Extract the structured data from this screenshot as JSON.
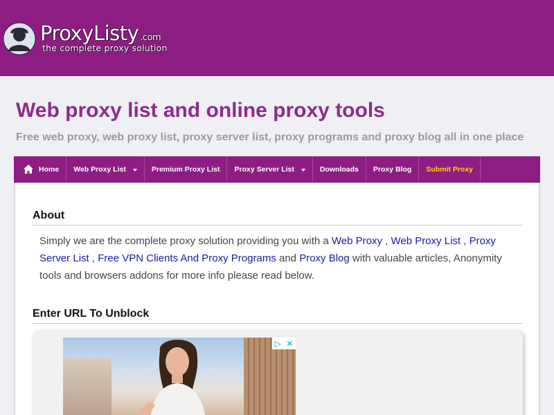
{
  "header": {
    "logo_text": "ProxyListy",
    "logo_tld": ".com",
    "logo_tagline": "the complete proxy solution"
  },
  "page": {
    "title": "Web proxy list and online proxy tools",
    "subtitle": "Free web proxy, web proxy list, proxy server list, proxy programs and proxy blog all in one place"
  },
  "nav": {
    "items": [
      {
        "label": "Home",
        "icon": "home-icon"
      },
      {
        "label": "Web Proxy List",
        "dropdown": true
      },
      {
        "label": "Premium Proxy List"
      },
      {
        "label": "Proxy Server List",
        "dropdown": true
      },
      {
        "label": "Downloads"
      },
      {
        "label": "Proxy Blog"
      },
      {
        "label": "Submit Proxy",
        "highlight": true
      }
    ]
  },
  "about": {
    "heading": "About",
    "t1": "Simply we are the complete proxy solution providing you with a ",
    "l1": "Web Proxy",
    "t2": " , ",
    "l2": "Web Proxy List",
    "t3": " , ",
    "l3": "Proxy Server List",
    "t4": " , ",
    "l4": "Free VPN Clients And Proxy Programs",
    "t5": " and ",
    "l5": "Proxy Blog",
    "t6": " with valuable articles, Anonymity tools and browsers addons for more info please read below."
  },
  "unblock": {
    "heading": "Enter URL To Unblock"
  },
  "ad": {
    "badge_icons": [
      "adchoices-icon",
      "close-icon"
    ]
  },
  "colors": {
    "brand": "#8e1d82",
    "title": "#8e2b8a",
    "link": "#1a1aa6",
    "highlight": "#ffd700"
  }
}
